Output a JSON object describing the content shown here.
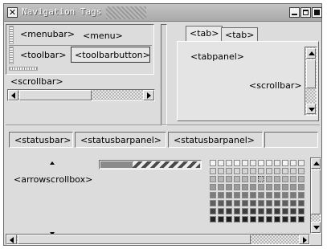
{
  "window": {
    "title": "Navigation Tags"
  },
  "toolbox": {
    "menubar_label": "<menubar>",
    "menu_label": "<menu>",
    "toolbar_label": "<toolbar>",
    "toolbarbutton_label": "<toolbarbutton>"
  },
  "scrollbar_label": "<scrollbar>",
  "tabbox": {
    "tabs": [
      {
        "label": "<tab>"
      },
      {
        "label": "<tab>"
      }
    ],
    "tabpanel_label": "<tabpanel>",
    "inner_scrollbar_label": "<scrollbar>"
  },
  "statusbar": {
    "label": "<statusbar>",
    "panels": [
      {
        "label": "<statusbarpanel>"
      },
      {
        "label": "<statusbarpanel>"
      }
    ]
  },
  "arrowscrollbox_label": "<arrowscrollbox>",
  "icons": [
    "close-icon",
    "minimize-icon",
    "maximize-icon",
    "window-close-icon",
    "arrow-left-icon",
    "arrow-right-icon",
    "arrow-up-icon",
    "arrow-down-icon"
  ]
}
